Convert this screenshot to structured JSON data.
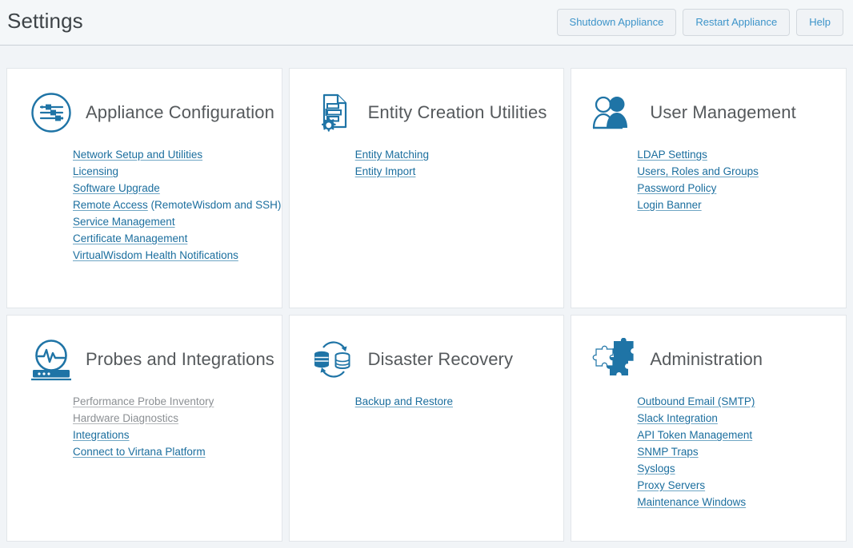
{
  "header": {
    "title": "Settings",
    "buttons": [
      {
        "label": "Shutdown Appliance",
        "name": "shutdown-appliance-button"
      },
      {
        "label": "Restart Appliance",
        "name": "restart-appliance-button"
      },
      {
        "label": "Help",
        "name": "help-button"
      }
    ]
  },
  "colors": {
    "page_background": "#f1f4f7",
    "card_background": "#ffffff",
    "card_border": "#e2e6ea",
    "link_blue": "#1b6e9e",
    "icon_blue": "#1f74a6",
    "button_text": "#3d94c9",
    "title_gray": "#55595c",
    "disabled_gray": "#8b8f93"
  },
  "cards": [
    {
      "title": "Appliance Configuration",
      "icon": "sliders-circle-icon",
      "links": [
        {
          "label": "Network Setup and Utilities",
          "suffix": "",
          "disabled": false
        },
        {
          "label": "Licensing",
          "suffix": "",
          "disabled": false
        },
        {
          "label": "Software Upgrade",
          "suffix": "",
          "disabled": false
        },
        {
          "label": "Remote Access",
          "suffix": " (RemoteWisdom and SSH)",
          "disabled": false
        },
        {
          "label": "Service Management",
          "suffix": "",
          "disabled": false
        },
        {
          "label": "Certificate Management",
          "suffix": "",
          "disabled": false
        },
        {
          "label": "VirtualWisdom Health Notifications",
          "suffix": "",
          "disabled": false
        }
      ]
    },
    {
      "title": "Entity Creation Utilities",
      "icon": "document-gear-icon",
      "links": [
        {
          "label": "Entity Matching",
          "suffix": "",
          "disabled": false
        },
        {
          "label": "Entity Import",
          "suffix": "",
          "disabled": false
        }
      ]
    },
    {
      "title": "User Management",
      "icon": "users-icon",
      "links": [
        {
          "label": "LDAP Settings",
          "suffix": "",
          "disabled": false
        },
        {
          "label": "Users, Roles and Groups",
          "suffix": "",
          "disabled": false
        },
        {
          "label": "Password Policy",
          "suffix": "",
          "disabled": false
        },
        {
          "label": "Login Banner",
          "suffix": "",
          "disabled": false
        }
      ]
    },
    {
      "title": "Probes and Integrations",
      "icon": "probe-monitor-icon",
      "links": [
        {
          "label": "Performance Probe Inventory",
          "suffix": "",
          "disabled": true
        },
        {
          "label": "Hardware Diagnostics",
          "suffix": "",
          "disabled": true
        },
        {
          "label": "Integrations",
          "suffix": "",
          "disabled": false
        },
        {
          "label": "Connect to Virtana Platform",
          "suffix": "",
          "disabled": false
        }
      ]
    },
    {
      "title": "Disaster Recovery",
      "icon": "database-sync-icon",
      "links": [
        {
          "label": "Backup and Restore",
          "suffix": "",
          "disabled": false
        }
      ]
    },
    {
      "title": "Administration",
      "icon": "puzzle-pieces-icon",
      "links": [
        {
          "label": "Outbound Email (SMTP)",
          "suffix": "",
          "disabled": false
        },
        {
          "label": "Slack Integration",
          "suffix": "",
          "disabled": false
        },
        {
          "label": "API Token Management",
          "suffix": "",
          "disabled": false
        },
        {
          "label": "SNMP Traps",
          "suffix": "",
          "disabled": false
        },
        {
          "label": "Syslogs",
          "suffix": "",
          "disabled": false
        },
        {
          "label": "Proxy Servers",
          "suffix": "",
          "disabled": false
        },
        {
          "label": "Maintenance Windows",
          "suffix": "",
          "disabled": false
        }
      ]
    }
  ]
}
